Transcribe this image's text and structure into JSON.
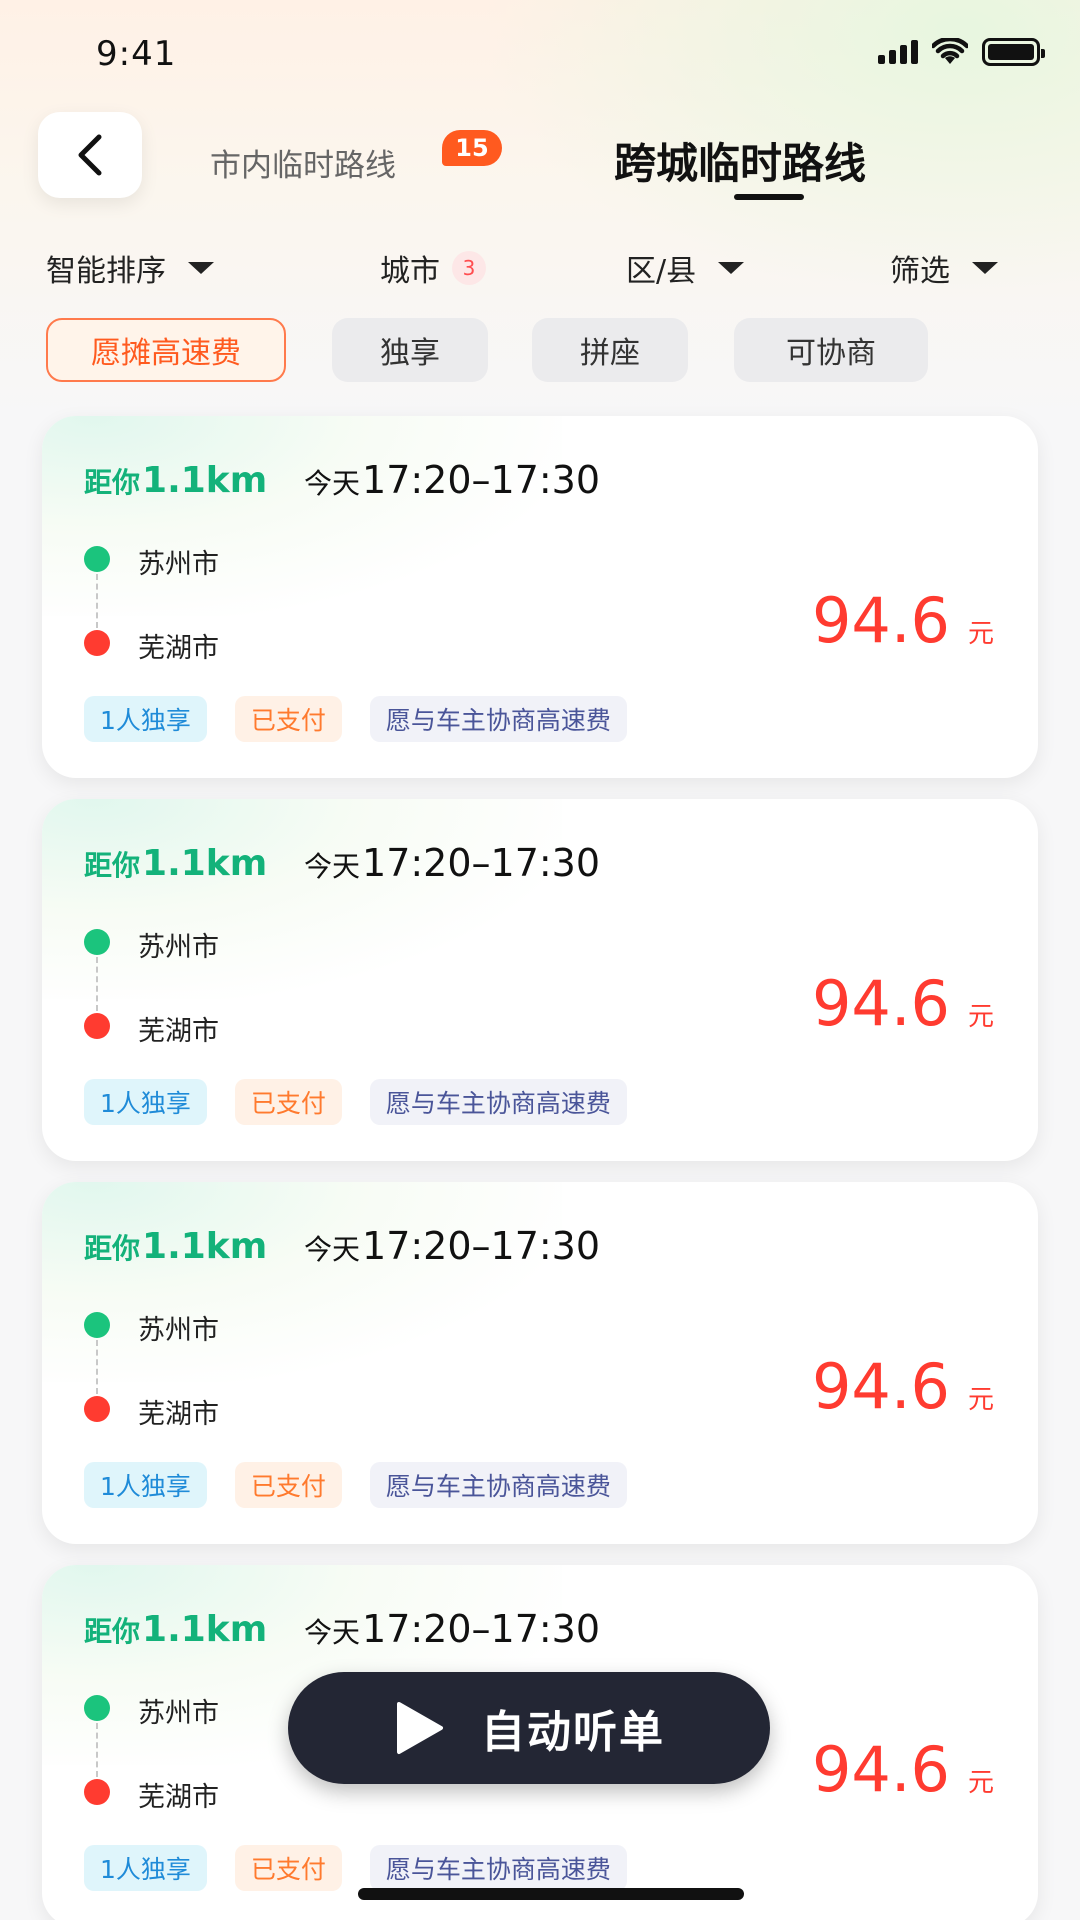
{
  "status_bar": {
    "time": "9:41"
  },
  "header": {
    "tabs": [
      {
        "label": "市内临时路线",
        "badge": "15",
        "active": false
      },
      {
        "label": "跨城临时路线",
        "active": true
      }
    ]
  },
  "filters": {
    "sort": "智能排序",
    "city": "城市",
    "city_count": "3",
    "district": "区/县",
    "filter": "筛选"
  },
  "chips": [
    {
      "label": "愿摊高速费",
      "active": true
    },
    {
      "label": "独享",
      "active": false
    },
    {
      "label": "拼座",
      "active": false
    },
    {
      "label": "可协商",
      "active": false
    }
  ],
  "orders": [
    {
      "distance_prefix": "距你",
      "distance": "1.1km",
      "day": "今天",
      "time_range": "17:20–17:30",
      "from": "苏州市",
      "to": "芜湖市",
      "price": "94.6",
      "unit": "元",
      "tags": [
        "1人独享",
        "已支付",
        "愿与车主协商高速费"
      ]
    },
    {
      "distance_prefix": "距你",
      "distance": "1.1km",
      "day": "今天",
      "time_range": "17:20–17:30",
      "from": "苏州市",
      "to": "芜湖市",
      "price": "94.6",
      "unit": "元",
      "tags": [
        "1人独享",
        "已支付",
        "愿与车主协商高速费"
      ]
    },
    {
      "distance_prefix": "距你",
      "distance": "1.1km",
      "day": "今天",
      "time_range": "17:20–17:30",
      "from": "苏州市",
      "to": "芜湖市",
      "price": "94.6",
      "unit": "元",
      "tags": [
        "1人独享",
        "已支付",
        "愿与车主协商高速费"
      ]
    },
    {
      "distance_prefix": "距你",
      "distance": "1.1km",
      "day": "今天",
      "time_range": "17:20–17:30",
      "from": "苏州市",
      "to": "芜湖市",
      "price": "94.6",
      "unit": "元",
      "tags": [
        "1人独享",
        "已支付",
        "愿与车主协商高速费"
      ]
    }
  ],
  "floating_button": {
    "label": "自动听单",
    "icon": "play-icon"
  },
  "colors": {
    "accent_orange": "#ff5a1f",
    "distance_green": "#13b27a",
    "price_red": "#ff3b30",
    "button_dark": "#232634"
  }
}
